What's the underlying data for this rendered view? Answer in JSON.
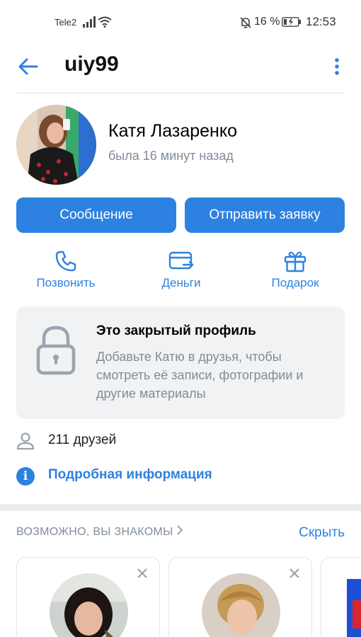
{
  "status_bar": {
    "carrier": "Tele2",
    "battery_percent": "16 %",
    "time": "12:53",
    "icons": [
      "signal-icon",
      "wifi-icon",
      "mute-icon",
      "battery-charging-icon"
    ]
  },
  "header": {
    "title": "uiy99",
    "back_icon": "back-arrow-icon",
    "more_icon": "more-vertical-icon"
  },
  "profile": {
    "name": "Катя Лазаренко",
    "last_seen": "была 16 минут назад"
  },
  "buttons": {
    "message": "Сообщение",
    "send_request": "Отправить заявку"
  },
  "actions": [
    {
      "icon": "phone-icon",
      "label": "Позвонить"
    },
    {
      "icon": "money-transfer-icon",
      "label": "Деньги"
    },
    {
      "icon": "gift-icon",
      "label": "Подарок"
    }
  ],
  "closed_profile": {
    "title": "Это закрытый профиль",
    "text": "Добавьте Катю в друзья, чтобы смотреть её записи, фотографии и другие материалы"
  },
  "friends": {
    "text": "211 друзей"
  },
  "details": {
    "text": "Подробная информация"
  },
  "recommendations": {
    "header": "ВОЗМОЖНО, ВЫ ЗНАКОМЫ",
    "hide": "Скрыть"
  },
  "colors": {
    "accent": "#2d81e0",
    "secondary_text": "#818c99",
    "card_bg": "#f1f2f4"
  }
}
